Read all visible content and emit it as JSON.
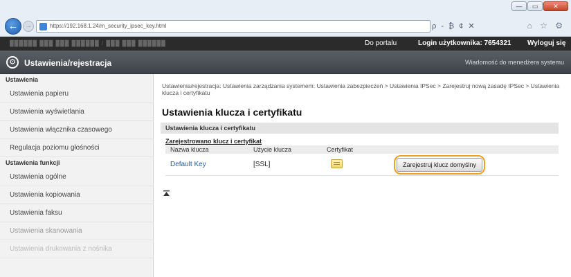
{
  "browser": {
    "url": "https://192.168.1.24/m_security_ipsec_key.html",
    "address_tools": "ρ - ₿ ¢ ✕",
    "window_buttons": {
      "minimize": "—",
      "maximize": "▭",
      "close": "✕"
    },
    "back": "←",
    "forward": "→",
    "nav_icons": "⌂ ☆ ⚙"
  },
  "topbar": {
    "device": "██████   ███ ███ ██████ / ███ ███ ██████",
    "portal": "Do portalu",
    "login": "Login użytkownika:  7654321",
    "logout": "Wyloguj się"
  },
  "header": {
    "title": "Ustawienia/rejestracja",
    "mail_admin": "Wiadomość do menedżera systemu",
    "gear_glyph": "⚙"
  },
  "sidebar": {
    "sections": [
      {
        "label": "Ustawienia",
        "items": [
          "Ustawienia papieru",
          "Ustawienia wyświetlania",
          "Ustawienia włącznika czasowego",
          "Regulacja poziomu głośności"
        ]
      },
      {
        "label": "Ustawienia funkcji",
        "items": [
          "Ustawienia ogólne",
          "Ustawienia kopiowania",
          "Ustawienia faksu",
          "Ustawienia skanowania",
          "Ustawienia drukowania z nośnika"
        ]
      }
    ]
  },
  "main": {
    "breadcrumb": "Ustawienia/rejestracja: Ustawienia zarządzania systemem: Ustawienia zabezpieczeń > Ustawienia IPSec > Zarejestruj nową zasadę IPSec > Ustawienia klucza i certyfikatu",
    "page_title": "Ustawienia klucza i certyfikatu",
    "section_title": "Ustawienia klucza i certyfikatu",
    "registered_label": "Zarejestrowano klucz i certyfikat",
    "columns": [
      "Nazwa klucza",
      "Użycie klucza",
      "Certyfikat",
      ""
    ],
    "rows": [
      {
        "key_name": "Default Key",
        "key_usage": "[SSL]",
        "button": "Zarejestruj klucz domyślny"
      }
    ],
    "top_arrow": "▲"
  },
  "colors": {
    "highlight_ring": "#f0a020",
    "link": "#1f5aa8",
    "header_bar": "#4a4e54",
    "top_bar": "#2b2b2b"
  }
}
